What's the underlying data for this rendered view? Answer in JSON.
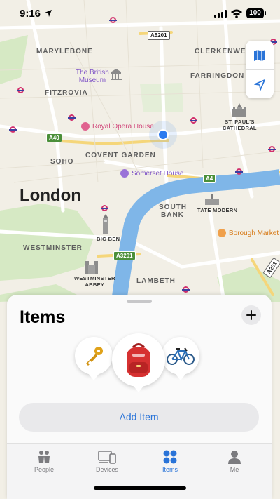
{
  "status_bar": {
    "time": "9:16",
    "battery": "100"
  },
  "map": {
    "city": "London",
    "areas": {
      "marylebone": "MARYLEBONE",
      "clerkenwell": "CLERKENWELL",
      "fitzrovia": "FITZROVIA",
      "farringdon": "FARRINGDON",
      "soho": "SOHO",
      "covent_garden": "COVENT GARDEN",
      "south_bank_1": "SOUTH",
      "south_bank_2": "BANK",
      "westminster": "WESTMINSTER",
      "lambeth": "LAMBETH"
    },
    "pois": {
      "british_museum_1": "The British",
      "british_museum_2": "Museum",
      "royal_opera_house": "Royal Opera House",
      "somerset_house": "Somerset House",
      "borough_market": "Borough Market"
    },
    "landmarks": {
      "st_pauls_1": "ST. PAUL'S",
      "st_pauls_2": "CATHEDRAL",
      "tate_modern": "TATE MODERN",
      "big_ben": "BIG BEN",
      "westminster_abbey_1": "WESTMINSTER",
      "westminster_abbey_2": "ABBEY"
    },
    "roads": {
      "a5201": "A5201",
      "a40": "A40",
      "a4": "A4",
      "a3201": "A3201",
      "a201": "A201"
    }
  },
  "sheet": {
    "title": "Items",
    "add_item_label": "Add Item"
  },
  "tabs": [
    {
      "label": "People",
      "icon": "people-icon"
    },
    {
      "label": "Devices",
      "icon": "devices-icon"
    },
    {
      "label": "Items",
      "icon": "items-icon",
      "active": true
    },
    {
      "label": "Me",
      "icon": "me-icon"
    }
  ],
  "colors": {
    "accent": "#2a74d8",
    "water": "#7fb6e8",
    "park": "#cfe6bf"
  }
}
